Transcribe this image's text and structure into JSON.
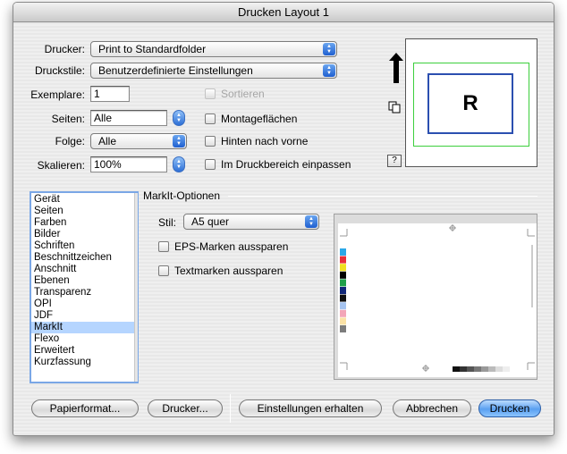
{
  "window": {
    "title": "Drucken Layout 1"
  },
  "form": {
    "drucker": {
      "label": "Drucker:",
      "value": "Print to Standardfolder"
    },
    "druckstile": {
      "label": "Druckstile:",
      "value": "Benutzerdefinierte Einstellungen"
    },
    "exemplare": {
      "label": "Exemplare:",
      "value": "1"
    },
    "seiten": {
      "label": "Seiten:",
      "value": "Alle"
    },
    "folge": {
      "label": "Folge:",
      "value": "Alle"
    },
    "skalieren": {
      "label": "Skalieren:",
      "value": "100%"
    }
  },
  "checkboxes": {
    "sortieren": "Sortieren",
    "montageflaechen": "Montageflächen",
    "hinten_nach_vorne": "Hinten nach vorne",
    "im_druckbereich": "Im Druckbereich einpassen"
  },
  "preview": {
    "letter": "R",
    "help": "?"
  },
  "sidebar": {
    "items": [
      "Gerät",
      "Seiten",
      "Farben",
      "Bilder",
      "Schriften",
      "Beschnittzeichen",
      "Anschnitt",
      "Ebenen",
      "Transparenz",
      "OPI",
      "JDF",
      "MarkIt",
      "Flexo",
      "Erweitert",
      "Kurzfassung"
    ],
    "selected": "MarkIt"
  },
  "markit": {
    "title": "MarkIt-Optionen",
    "stil_label": "Stil:",
    "stil_value": "A5 quer",
    "eps_label": "EPS-Marken aussparen",
    "text_label": "Textmarken aussparen",
    "color_bar": [
      "#2aa8e8",
      "#e8303a",
      "#f0e020",
      "#000000",
      "#1fa04a",
      "#12287a",
      "#101010",
      "#a6c4f0",
      "#f3a6b8",
      "#fbe2a6",
      "#7c7c7c"
    ]
  },
  "buttons": {
    "papierformat": "Papierformat...",
    "drucker": "Drucker...",
    "einstellungen": "Einstellungen erhalten",
    "abbrechen": "Abbrechen",
    "drucken": "Drucken"
  },
  "colors": {
    "accent": "#5aa0f0",
    "selection": "#b5d5ff",
    "preview_border": "#2b4fb0",
    "preview_area": "#3ccf3c"
  }
}
